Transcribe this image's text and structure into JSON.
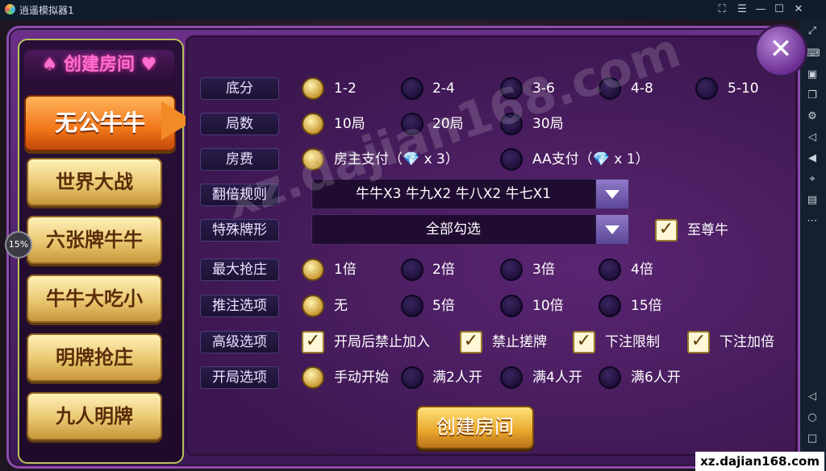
{
  "window": {
    "title": "逍遥模拟器1",
    "percent": "15%"
  },
  "left_panel": {
    "title": "♠ 创建房间 ♥",
    "modes": [
      "无公牛牛",
      "世界大战",
      "六张牌牛牛",
      "牛牛大吃小",
      "明牌抢庄",
      "九人明牌"
    ],
    "active_index": 0
  },
  "rows": {
    "difen": {
      "label": "底分",
      "options": [
        "1-2",
        "2-4",
        "3-6",
        "4-8",
        "5-10"
      ],
      "selected": 0
    },
    "jushu": {
      "label": "局数",
      "options": [
        "10局",
        "20局",
        "30局"
      ],
      "selected": 0
    },
    "fangfei": {
      "label": "房费",
      "options": [
        "房主支付（💎 x 3）",
        "AA支付（💎 x 1）"
      ],
      "selected": 0
    },
    "fanbei": {
      "label": "翻倍规则",
      "value": "牛牛X3 牛九X2 牛八X2 牛七X1"
    },
    "teshu": {
      "label": "特殊牌形",
      "value": "全部勾选",
      "check_label": "至尊牛",
      "checked": true
    },
    "qiangzhuang": {
      "label": "最大抢庄",
      "options": [
        "1倍",
        "2倍",
        "3倍",
        "4倍"
      ],
      "selected": 0
    },
    "tuizhu": {
      "label": "推注选项",
      "options": [
        "无",
        "5倍",
        "10倍",
        "15倍"
      ],
      "selected": 0
    },
    "gaoji": {
      "label": "高级选项",
      "options": [
        "开局后禁止加入",
        "禁止搓牌",
        "下注限制",
        "下注加倍"
      ],
      "checked": [
        true,
        true,
        true,
        true
      ]
    },
    "kaiju": {
      "label": "开局选项",
      "options": [
        "手动开始",
        "满2人开",
        "满4人开",
        "满6人开"
      ],
      "selected": 0
    }
  },
  "create_button": "创建房间",
  "watermark": "xz.dajian168.com",
  "footer": "xz.dajian168.com"
}
